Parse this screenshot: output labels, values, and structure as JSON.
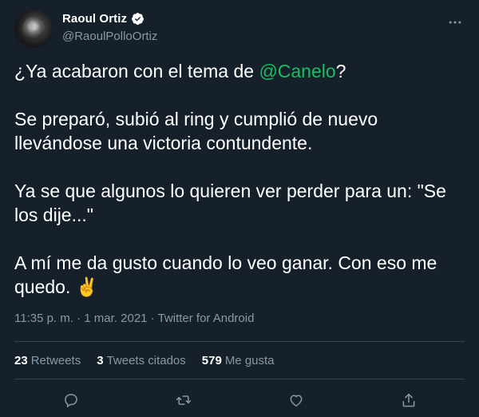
{
  "author": {
    "name": "Raoul Ortiz",
    "handle": "@RaoulPolloOrtiz"
  },
  "tweet": {
    "line1_prefix": "¿Ya acabaron con el tema de ",
    "mention": "@Canelo",
    "line1_suffix": "?",
    "paragraph2": "Se preparó, subió al ring y cumplió de nuevo llevándose una victoria contundente.",
    "paragraph3": "Ya se que algunos lo quieren ver perder para un: \"Se los dije...\"",
    "paragraph4": "A mí me da gusto cuando lo veo ganar. Con eso me quedo. ✌️"
  },
  "meta": {
    "time": "11:35 p. m.",
    "sep1": " · ",
    "date": "1 mar. 2021",
    "sep2": " · ",
    "source": "Twitter for Android"
  },
  "stats": {
    "retweets_count": "23",
    "retweets_label": "Retweets",
    "quotes_count": "3",
    "quotes_label": "Tweets citados",
    "likes_count": "579",
    "likes_label": "Me gusta"
  },
  "icons": {
    "more": "more-icon",
    "verified": "verified-badge-icon",
    "reply": "reply-icon",
    "retweet": "retweet-icon",
    "like": "heart-icon",
    "share": "share-icon"
  },
  "colors": {
    "background": "#15202b",
    "mention": "#17bf63",
    "secondary_text": "#8899a6",
    "divider": "#38444d"
  }
}
